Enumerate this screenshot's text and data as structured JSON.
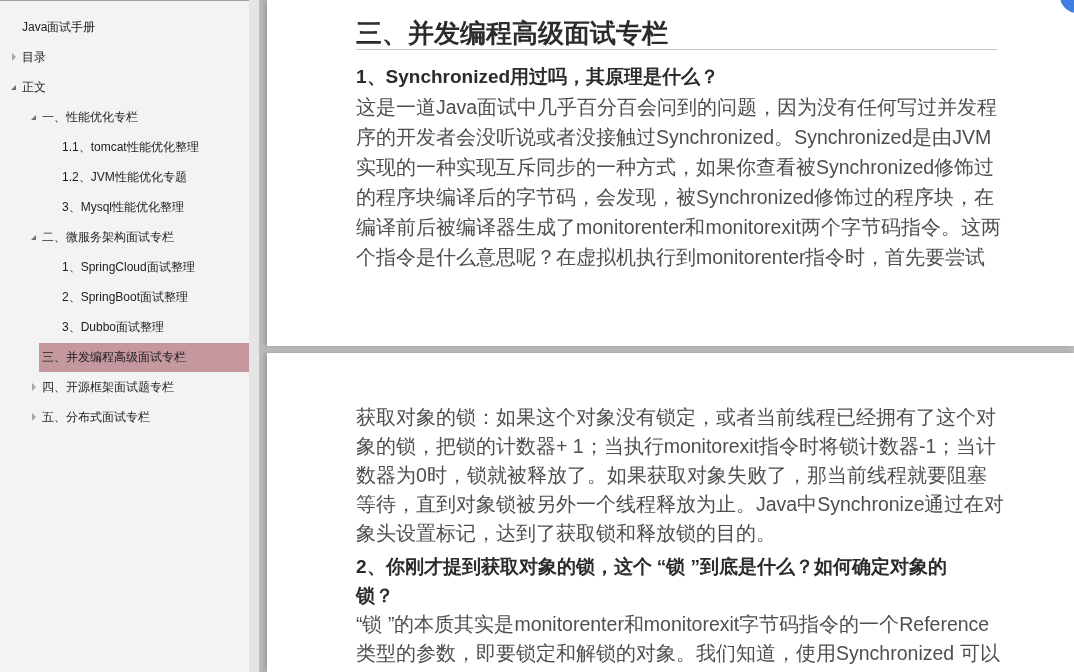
{
  "sidebar": {
    "items": [
      {
        "label": "Java面试手册",
        "selected": false
      },
      {
        "label": "目录",
        "selected": false,
        "expanded": false
      },
      {
        "label": "正文",
        "selected": false,
        "expanded": true,
        "children": [
          {
            "label": "一、性能优化专栏",
            "selected": false,
            "expanded": true,
            "children": [
              {
                "label": "1.1、tomcat性能优化整理",
                "selected": false
              },
              {
                "label": "1.2、JVM性能优化专题",
                "selected": false
              },
              {
                "label": "3、Mysql性能优化整理",
                "selected": false
              }
            ]
          },
          {
            "label": "二、微服务架构面试专栏",
            "selected": false,
            "expanded": true,
            "children": [
              {
                "label": "1、SpringCloud面试整理",
                "selected": false
              },
              {
                "label": "2、SpringBoot面试整理",
                "selected": false
              },
              {
                "label": "3、Dubbo面试整理",
                "selected": false
              }
            ]
          },
          {
            "label": "三、并发编程高级面试专栏",
            "selected": true
          },
          {
            "label": "四、开源框架面试题专栏",
            "selected": false,
            "expanded": false
          },
          {
            "label": "五、分布式面试专栏",
            "selected": false,
            "expanded": false
          }
        ]
      }
    ]
  },
  "document": {
    "pages": [
      {
        "blocks": [
          {
            "kind": "title",
            "lines": [
              "三、并发编程高级面试专栏"
            ]
          },
          {
            "kind": "subheading",
            "lines": [
              "1、Synchronized用过吗，其原理是什么？"
            ]
          },
          {
            "kind": "paragraph",
            "lines": [
              "这是一道Java面试中几乎百分百会问到的问题，因为没有任何写过并发程",
              "序的开发者会没听说或者没接触过Synchronized。Synchronized是由JVM",
              "实现的一种实现互斥同步的一种方式，如果你查看被Synchronized修饰过",
              "的程序块编译后的字节码，会发现，被Synchronized修饰过的程序块，在",
              "编译前后被编译器生成了monitorenter和monitorexit两个字节码指令。这两",
              "个指令是什么意思呢？在虚拟机执行到monitorenter指令时，首先要尝试"
            ]
          }
        ]
      },
      {
        "blocks": [
          {
            "kind": "paragraph",
            "lines": [
              "获取对象的锁：如果这个对象没有锁定，或者当前线程已经拥有了这个对",
              "象的锁，把锁的计数器+ 1；当执行monitorexit指令时将锁计数器-1；当计",
              "数器为0时，锁就被释放了。如果获取对象失败了，那当前线程就要阻塞",
              "等待，直到对象锁被另外一个线程释放为止。Java中Synchronize通过在对",
              "象头设置标记，达到了获取锁和释放锁的目的。"
            ]
          },
          {
            "kind": "subheading",
            "lines": [
              "2、你刚才提到获取对象的锁，这个 “锁 ”到底是什么？如何确定对象的",
              "锁？"
            ]
          },
          {
            "kind": "paragraph",
            "lines": [
              "“锁 ”的本质其实是monitorenter和monitorexit字节码指令的一个Reference",
              "类型的参数，即要锁定和解锁的对象。我们知道，使用Synchronized 可以"
            ]
          }
        ]
      }
    ]
  }
}
